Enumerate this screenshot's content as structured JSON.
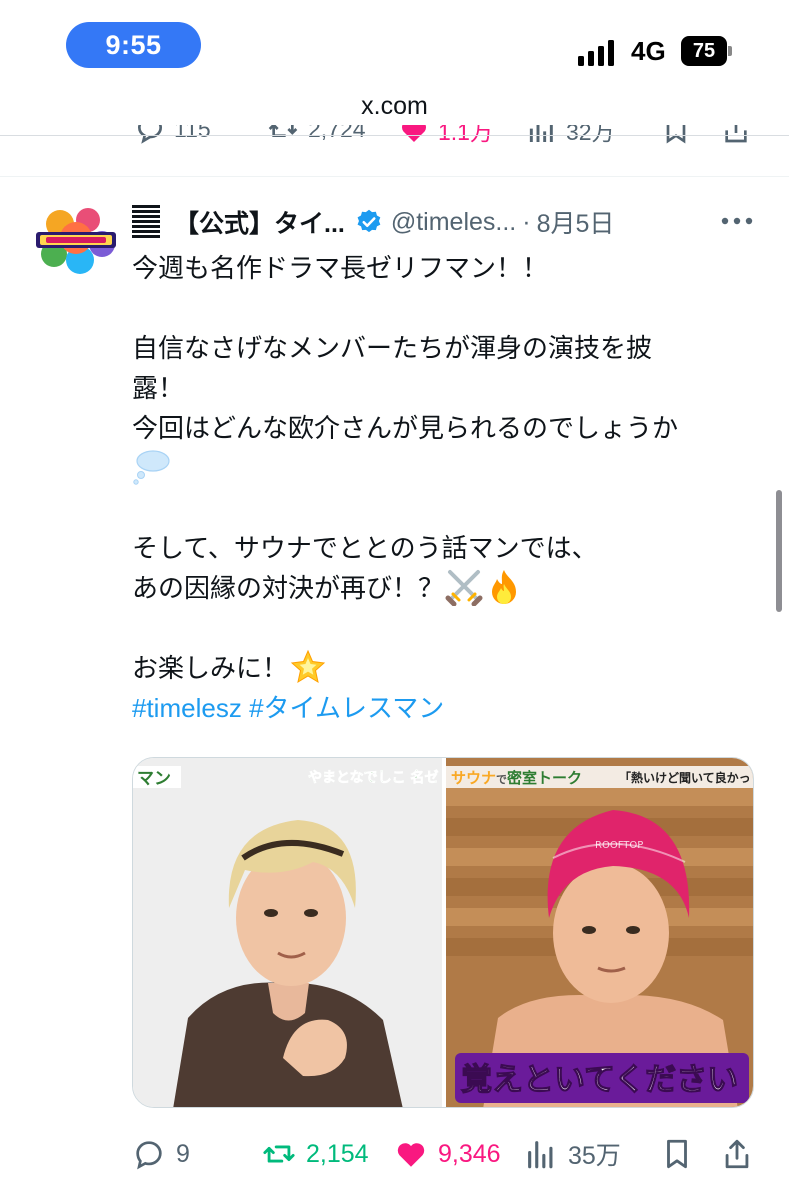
{
  "status_bar": {
    "time": "9:55",
    "network": "4G",
    "battery": "75",
    "accent_color": "#3478f6"
  },
  "browser": {
    "url": "x.com"
  },
  "prev_tweet": {
    "reply_count": "115",
    "retweet_count": "2,724",
    "like_count": "1.1万",
    "view_count": "32万"
  },
  "tweet": {
    "author": "【公式】タイ...",
    "handle": "@timeles...",
    "separator": "·",
    "date": "8月5日",
    "lines": {
      "l1": "今週も名作ドラマ長ゼリフマン！！",
      "l2": "自信なさげなメンバーたちが渾身の演技を披",
      "l3": "露！",
      "l4": "今回はどんな欧介さんが見られるのでしょうか",
      "l5": "そして、サウナでととのう話マンでは、",
      "l6": "あの因縁の対決が再び！？",
      "l7": "お楽しみに！"
    },
    "emoji": {
      "l4": "thought-balloon-icon",
      "l6": [
        "crossed-swords-icon",
        "fire-icon"
      ],
      "l7": "glowing-star-icon"
    },
    "hashtags": [
      "#timelesz",
      "#タイムレスマン"
    ],
    "media": {
      "left_tag": "マン",
      "left_caption": "やまとなでしこ 名ゼ",
      "right_tag_a": "サウナ",
      "right_tag_b": "で",
      "right_tag_c": "密室トーク",
      "right_quote": "「熱いけど聞いて良かっ",
      "right_subtitle": "覚えといてください",
      "cap_label": "ROOFTOP"
    },
    "actions": {
      "reply_count": "9",
      "retweet_count": "2,154",
      "like_count": "9,346",
      "view_count": "35万"
    }
  },
  "colors": {
    "link": "#1d9bf0",
    "retweet": "#00ba7c",
    "like": "#f91880",
    "muted": "#536471"
  }
}
